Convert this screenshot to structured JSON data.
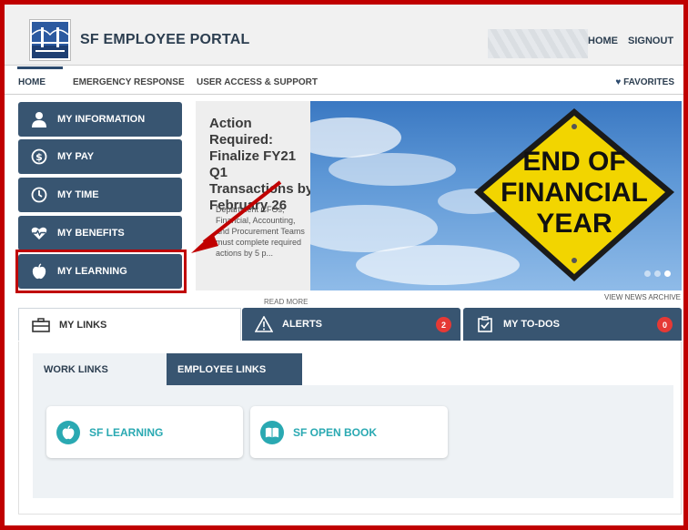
{
  "header": {
    "title": "SF EMPLOYEE PORTAL",
    "links": {
      "home": "HOME",
      "signout": "SIGNOUT"
    }
  },
  "nav": {
    "items": [
      "HOME",
      "EMERGENCY RESPONSE",
      "USER ACCESS & SUPPORT"
    ],
    "favorites": "FAVORITES"
  },
  "menu": {
    "items": [
      "MY INFORMATION",
      "MY PAY",
      "MY TIME",
      "MY BENEFITS",
      "MY LEARNING"
    ],
    "icons": [
      "user-icon",
      "dollar-icon",
      "clock-icon",
      "heart-pulse-icon",
      "apple-icon"
    ]
  },
  "news": {
    "title": "Action Required: Finalize FY21 Q1 Transactions by February 26",
    "body": "Department CFOs, Financial, Accounting, and Procurement Teams must complete required actions by 5 p...",
    "read_more": "READ MORE",
    "view_archive": "VIEW NEWS ARCHIVE"
  },
  "banner": {
    "sign_lines": [
      "END OF",
      "FINANCIAL",
      "YEAR"
    ]
  },
  "tabs": {
    "my_links": "MY LINKS",
    "alerts": "ALERTS",
    "alerts_count": "2",
    "todos": "MY TO-DOS",
    "todos_count": "0"
  },
  "links_panel": {
    "subtabs": [
      "WORK LINKS",
      "EMPLOYEE LINKS"
    ],
    "cards": [
      "SF LEARNING",
      "SF OPEN BOOK"
    ]
  },
  "colors": {
    "primary": "#385571",
    "accent": "#2aa9b2",
    "annotation": "#c00000",
    "badge": "#e53935"
  }
}
